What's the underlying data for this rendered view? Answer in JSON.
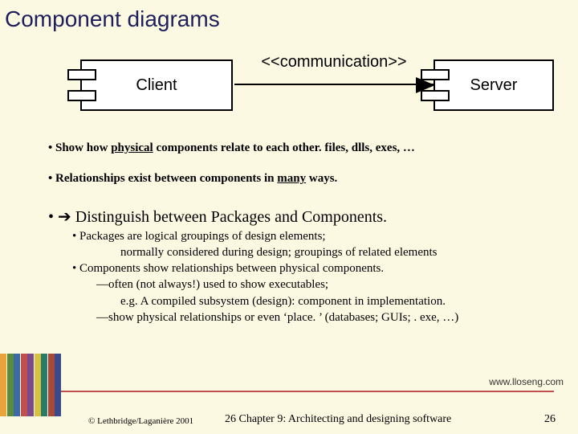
{
  "title": "Component diagrams",
  "diagram": {
    "client": "Client",
    "server": "Server",
    "stereotype": "<<communication>>"
  },
  "bullets": {
    "b1_pre": "• Show how ",
    "b1_u": "physical",
    "b1_post": " components relate to each other.  files, dlls, exes, …",
    "b2_pre": "• Relationships exist between components in ",
    "b2_u": "many",
    "b2_post": " ways.",
    "b3_pre": "• ",
    "b3_arrow": "➔",
    "b3_post": "  Distinguish between Packages and Components.",
    "s1": "•  Packages are logical groupings of design elements;",
    "s1b": "normally considered during design;  groupings of related elements",
    "s2": "•  Components show  relationships between physical components.",
    "s2a": "—often (not always!) used to show executables;",
    "s2a2": "e.g.  A compiled subsystem (design):  component in implementation.",
    "s2b": "—show physical relationships or even ‘place. ’ (databases;  GUIs;  . exe, …)"
  },
  "footer": {
    "url": "www.lloseng.com",
    "copyright": "© Lethbridge/Laganière 2001",
    "chapter": "26 Chapter 9: Architecting and designing software",
    "page": "26"
  },
  "stripe_colors": [
    "#e8a33a",
    "#5a8a3a",
    "#3a6aa8",
    "#c0504d",
    "#7a4a8a",
    "#d8c040",
    "#2a7a6a",
    "#a84a3a",
    "#3a4a8a"
  ]
}
